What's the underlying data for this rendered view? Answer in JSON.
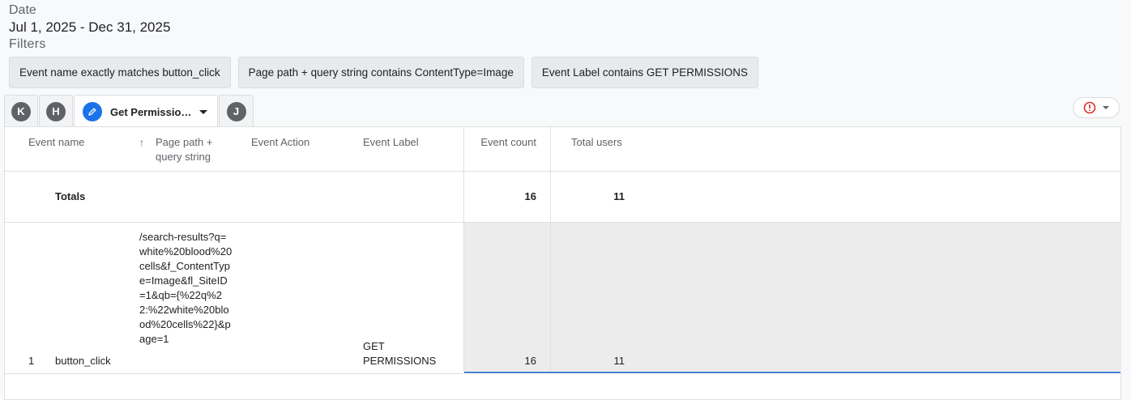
{
  "date": {
    "label": "Date",
    "range": "Jul 1, 2025 - Dec 31, 2025"
  },
  "filters": {
    "label": "Filters",
    "chips": [
      "Event name exactly matches button_click",
      "Page path + query string contains ContentType=Image",
      "Event Label contains GET PERMISSIONS"
    ]
  },
  "tabs": {
    "avatars": [
      "K",
      "H",
      "J"
    ],
    "active_label": "Get Permissio…"
  },
  "table": {
    "columns": {
      "event_name": "Event name",
      "page_path": "Page path +\nquery string",
      "event_action": "Event Action",
      "event_label": "Event Label",
      "event_count": "Event count",
      "total_users": "Total users"
    },
    "sort_icon": "arrow-up-icon",
    "totals": {
      "label": "Totals",
      "event_count": "16",
      "total_users": "11"
    },
    "rows": [
      {
        "index": "1",
        "event_name": "button_click",
        "page_path": "/search-results?q=white%20blood%20cells&f_ContentType=Image&fl_SiteID=1&qb={%22q%22:%22white%20blood%20cells%22}&page=1",
        "event_action": "",
        "event_label": "GET PERMISSIONS",
        "event_count": "16",
        "total_users": "11"
      }
    ]
  },
  "colors": {
    "accent": "#1a73e8",
    "alert": "#d93025",
    "chip_bg": "#e8eaed"
  }
}
